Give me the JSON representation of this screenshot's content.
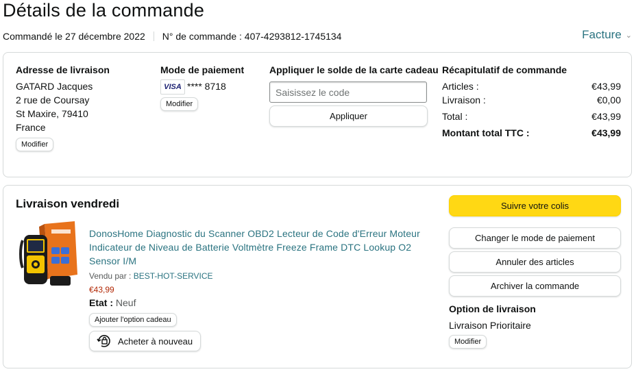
{
  "header": {
    "title": "Détails de la commande",
    "order_date": "Commandé le 27 décembre 2022",
    "order_number": "N° de commande : 407-4293812-1745134",
    "invoice_label": "Facture"
  },
  "shipping": {
    "title": "Adresse de livraison",
    "lines": [
      "GATARD Jacques",
      "2 rue de Coursay",
      "St Maxire, 79410",
      "France"
    ],
    "modify_label": "Modifier"
  },
  "payment": {
    "title": "Mode de paiement",
    "card_brand": "VISA",
    "card_number": "**** 8718",
    "modify_label": "Modifier"
  },
  "gift_card": {
    "title": "Appliquer le solde de la carte cadeau",
    "placeholder": "Saisissez le code",
    "apply_label": "Appliquer"
  },
  "summary": {
    "title": "Récapitulatif de commande",
    "items_label": "Articles :",
    "items_value": "€43,99",
    "shipping_label": "Livraison :",
    "shipping_value": "€0,00",
    "total_label": "Total :",
    "total_value": "€43,99",
    "grand_total_label": "Montant total TTC :",
    "grand_total_value": "€43,99"
  },
  "delivery": {
    "title": "Livraison vendredi",
    "product": {
      "title": "DonosHome Diagnostic du Scanner OBD2 Lecteur de Code d'Erreur Moteur Indicateur de Niveau de Batterie Voltmètre Freeze Frame DTC Lookup O2 Sensor I/M",
      "sold_by_label": "Vendu par :",
      "seller": "BEST-HOT-SERVICE",
      "price": "€43,99",
      "state_label": "Etat :",
      "state_value": "Neuf",
      "gift_option_label": "Ajouter l'option cadeau",
      "rebuy_label": "Acheter à nouveau"
    },
    "actions": {
      "track": "Suivre votre colis",
      "change_payment": "Changer le mode de paiement",
      "cancel": "Annuler des articles",
      "archive": "Archiver la commande"
    },
    "option": {
      "title": "Option de livraison",
      "value": "Livraison Prioritaire",
      "modify_label": "Modifier"
    }
  },
  "colors": {
    "link": "#2a7380",
    "price": "#b12704",
    "primary_button": "#ffd814",
    "border": "#d5d9d9"
  }
}
